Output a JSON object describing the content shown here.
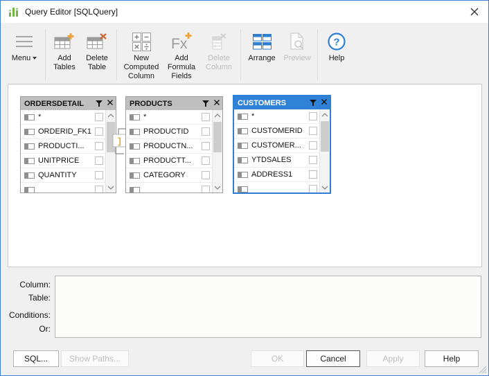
{
  "window": {
    "title": "Query Editor [SQLQuery]"
  },
  "toolbar": {
    "menu_label": "Menu",
    "add_tables": "Add Tables",
    "delete_table": "Delete Table",
    "new_computed_column": "New Computed Column",
    "add_formula_fields": "Add Formula Fields",
    "delete_column": "Delete Column",
    "arrange": "Arrange",
    "preview": "Preview",
    "help": "Help"
  },
  "tables": {
    "ordersdetail": {
      "name": "ORDERSDETAIL",
      "fields": [
        "*",
        "ORDERID_FK1",
        "PRODUCTI...",
        "UNITPRICE",
        "QUANTITY"
      ]
    },
    "products": {
      "name": "PRODUCTS",
      "fields": [
        "*",
        "PRODUCTID",
        "PRODUCTN...",
        "PRODUCTT...",
        "CATEGORY"
      ]
    },
    "customers": {
      "name": "CUSTOMERS",
      "fields": [
        "*",
        "CUSTOMERID",
        "CUSTOMER...",
        "YTDSALES",
        "ADDRESS1"
      ],
      "selected": true
    }
  },
  "join": {
    "symbol": "]"
  },
  "conditions": {
    "labels": [
      "Column:",
      "Table:",
      "Conditions:",
      "Or:"
    ]
  },
  "footer": {
    "sql": "SQL...",
    "show_paths": "Show Paths...",
    "ok": "OK",
    "cancel": "Cancel",
    "apply": "Apply",
    "help": "Help"
  },
  "icons": {
    "fx": "Fx",
    "question": "?"
  },
  "colors": {
    "window_border": "#3e7fd6",
    "selected_blue": "#2f82d8",
    "header_gray": "#bfbfbf",
    "plus_yellow": "#f0a53c",
    "delete_orange": "#c96a35",
    "icon_gray": "#9a9a9a",
    "logo_green": "#72b840"
  }
}
